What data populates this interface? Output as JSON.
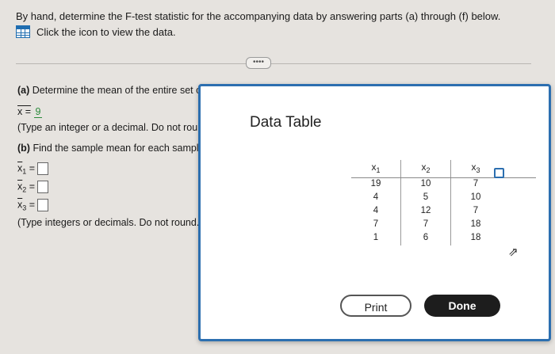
{
  "instruction": "By hand, determine the F-test statistic for the accompanying data by answering parts (a) through (f) below.",
  "data_link": "Click the icon to view the data.",
  "expand_label": "••••",
  "part_a": {
    "label": "(a)",
    "text": "Determine the mean of the entire set of",
    "answer_prefix": "x =",
    "answer_value": "9",
    "hint": "(Type an integer or a decimal. Do not roun"
  },
  "part_b": {
    "label": "(b)",
    "text": "Find the sample mean for each sample",
    "inputs": [
      {
        "var": "x",
        "sub": "1",
        "eq": "="
      },
      {
        "var": "x",
        "sub": "2",
        "eq": "="
      },
      {
        "var": "x",
        "sub": "3",
        "eq": "="
      }
    ],
    "hint": "(Type integers or decimals. Do not round.)"
  },
  "dialog": {
    "title": "Data Table",
    "columns": [
      {
        "var": "x",
        "sub": "1"
      },
      {
        "var": "x",
        "sub": "2"
      },
      {
        "var": "x",
        "sub": "3"
      }
    ],
    "rows": [
      [
        "19",
        "10",
        "7"
      ],
      [
        "4",
        "5",
        "10"
      ],
      [
        "4",
        "12",
        "7"
      ],
      [
        "7",
        "7",
        "18"
      ],
      [
        "1",
        "6",
        "18"
      ]
    ],
    "copy_icon": "copy-icon",
    "print_label": "Print",
    "done_label": "Done"
  },
  "colors": {
    "accent": "#2c6fb0",
    "answer_green": "#2a8a3a",
    "done_bg": "#1d1d1d"
  }
}
